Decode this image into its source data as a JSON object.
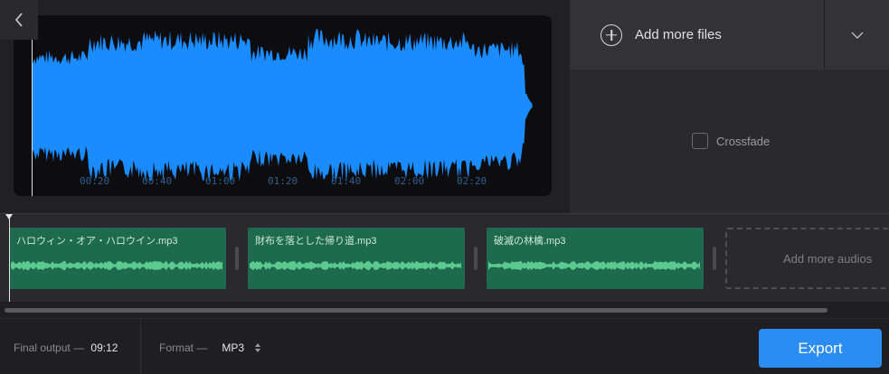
{
  "waveform": {
    "color": "#1a8cff",
    "time_labels": [
      "00:20",
      "00:40",
      "01:00",
      "01:20",
      "01:40",
      "02:00",
      "02:20"
    ]
  },
  "right_panel": {
    "add_files_label": "Add more files",
    "crossfade_label": "Crossfade"
  },
  "timeline": {
    "clips": [
      {
        "name": "ハロウィン・オア・ハロウイン.mp3"
      },
      {
        "name": "財布を落とした帰り道.mp3"
      },
      {
        "name": "破滅の林檎.mp3"
      }
    ],
    "add_audios_label": "Add more audios",
    "clip_color": "#1d6a4f"
  },
  "bottom_bar": {
    "final_output_label": "Final output —",
    "final_output_value": "09:12",
    "format_label": "Format —",
    "format_value": "MP3",
    "export_label": "Export",
    "export_color": "#2b8cf3"
  }
}
